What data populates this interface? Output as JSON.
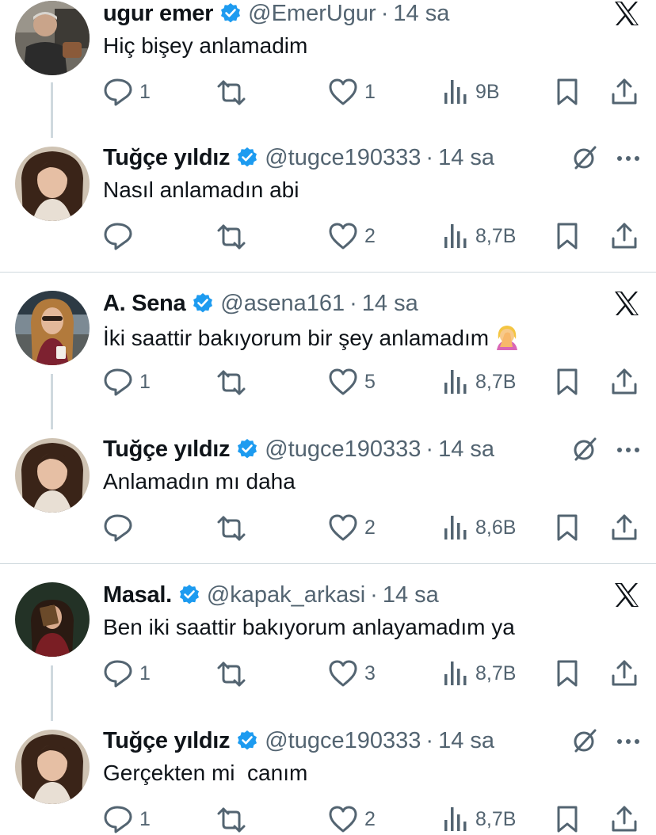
{
  "tweets": [
    {
      "name": "ugur emer",
      "handle": "@EmerUgur",
      "dot": "·",
      "time": "14 sa",
      "text": "Hiç bişey anlamadim",
      "replies": "1",
      "retweets": "",
      "likes": "1",
      "views": "9B",
      "corner": "x-logo-icon",
      "avatar": "man-in-car"
    },
    {
      "name": "Tuğçe yıldız",
      "handle": "@tugce190333",
      "dot": "·",
      "time": "14 sa",
      "text": "Nasıl anlamadın abi",
      "replies": "",
      "retweets": "",
      "likes": "2",
      "views": "8,7B",
      "corner": "grok-icon",
      "avatar": "woman-dark-hair"
    },
    {
      "name": "A. Sena",
      "handle": "@asena161",
      "dot": "·",
      "time": "14 sa",
      "text": "İki saattir bakıyorum bir şey anlamadım",
      "emoji": "facepalm-woman-emoji",
      "replies": "1",
      "retweets": "",
      "likes": "5",
      "views": "8,7B",
      "corner": "x-logo-icon",
      "avatar": "woman-curly-hair"
    },
    {
      "name": "Tuğçe yıldız",
      "handle": "@tugce190333",
      "dot": "·",
      "time": "14 sa",
      "text": "Anlamadın mı daha",
      "replies": "",
      "retweets": "",
      "likes": "2",
      "views": "8,6B",
      "corner": "grok-icon",
      "avatar": "woman-dark-hair"
    },
    {
      "name": "Masal.",
      "handle": "@kapak_arkasi",
      "dot": "·",
      "time": "14 sa",
      "text": "Ben iki saattir bakıyorum anlayamadım ya",
      "replies": "1",
      "retweets": "",
      "likes": "3",
      "views": "8,7B",
      "corner": "x-logo-icon",
      "avatar": "woman-with-book"
    },
    {
      "name": "Tuğçe yıldız",
      "handle": "@tugce190333",
      "dot": "·",
      "time": "14 sa",
      "text": "Gerçekten mi  canım",
      "replies": "1",
      "retweets": "",
      "likes": "2",
      "views": "8,7B",
      "corner": "grok-icon",
      "avatar": "woman-dark-hair"
    }
  ],
  "colors": {
    "verified": "#1d9bf0",
    "text": "#0f1419",
    "muted": "#536471",
    "divider": "#cfd9de"
  }
}
